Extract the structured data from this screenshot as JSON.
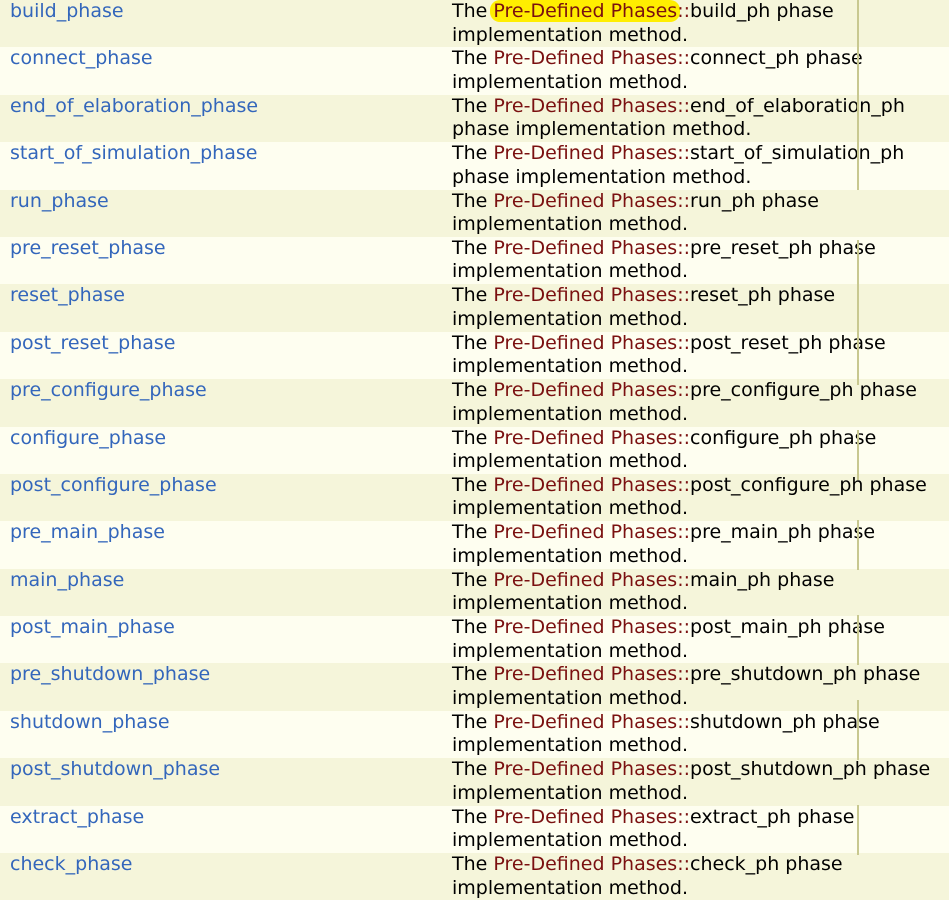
{
  "text": {
    "prefix": "The ",
    "class_name": "Pre-Defined Phases",
    "separator": "::",
    "suffix": " phase implementation method."
  },
  "rows": [
    {
      "name": "build_phase",
      "ph": "build_ph"
    },
    {
      "name": "connect_phase",
      "ph": "connect_ph"
    },
    {
      "name": "end_of_elaboration_phase",
      "ph": "end_of_elaboration_ph"
    },
    {
      "name": "start_of_simulation_phase",
      "ph": "start_of_simulation_ph"
    },
    {
      "name": "run_phase",
      "ph": "run_ph"
    },
    {
      "name": "pre_reset_phase",
      "ph": "pre_reset_ph"
    },
    {
      "name": "reset_phase",
      "ph": "reset_ph"
    },
    {
      "name": "post_reset_phase",
      "ph": "post_reset_ph"
    },
    {
      "name": "pre_configure_phase",
      "ph": "pre_configure_ph"
    },
    {
      "name": "configure_phase",
      "ph": "configure_ph"
    },
    {
      "name": "post_configure_phase",
      "ph": "post_configure_ph"
    },
    {
      "name": "pre_main_phase",
      "ph": "pre_main_ph"
    },
    {
      "name": "main_phase",
      "ph": "main_ph"
    },
    {
      "name": "post_main_phase",
      "ph": "post_main_ph"
    },
    {
      "name": "pre_shutdown_phase",
      "ph": "pre_shutdown_ph"
    },
    {
      "name": "shutdown_phase",
      "ph": "shutdown_ph"
    },
    {
      "name": "post_shutdown_phase",
      "ph": "post_shutdown_ph"
    },
    {
      "name": "extract_phase",
      "ph": "extract_ph"
    },
    {
      "name": "check_phase",
      "ph": "check_ph"
    }
  ],
  "colors": {
    "link": "#3366bb",
    "class_link": "#7a1010",
    "highlight": "#ffee00",
    "row_even": "#f5f5da",
    "row_odd": "#fefef0"
  }
}
